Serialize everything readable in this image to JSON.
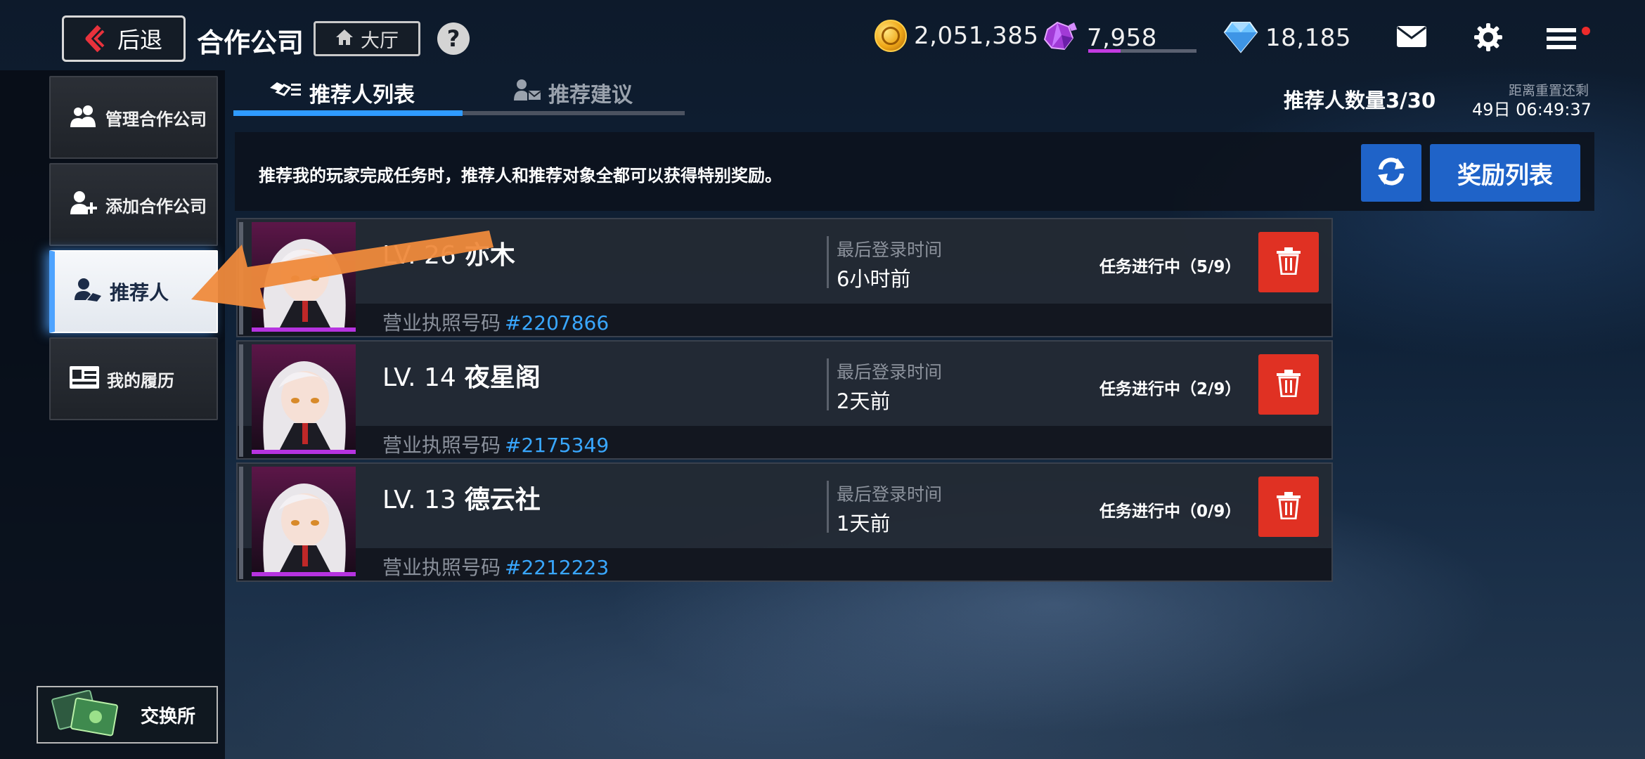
{
  "header": {
    "back_label": "后退",
    "company_title": "合作公司",
    "hall_label": "大厅",
    "help_symbol": "?",
    "currencies": [
      {
        "icon": "gold-coin-icon",
        "value": "2,051,385"
      },
      {
        "icon": "purple-crystal-icon",
        "value": "7,958",
        "bar_fill_fraction": 0.3
      },
      {
        "icon": "blue-diamond-icon",
        "value": "18,185"
      }
    ],
    "icons": [
      "mail-icon",
      "settings-icon",
      "menu-icon"
    ],
    "notify_color": "#ee2b2b"
  },
  "sidebar": {
    "items": [
      {
        "label": "管理合作公司",
        "icon": "users-icon",
        "active": false
      },
      {
        "label": "添加合作公司",
        "icon": "add-user-icon",
        "active": false
      },
      {
        "label": "推荐人",
        "icon": "handshake-icon",
        "active": true
      },
      {
        "label": "我的履历",
        "icon": "profile-card-icon",
        "active": false
      }
    ],
    "exchange_label": "交换所",
    "active_color": "#4ea3ff"
  },
  "tabs": [
    {
      "label": "推荐人列表",
      "icon": "handshake-list-icon",
      "active": true
    },
    {
      "label": "推荐建议",
      "icon": "user-mail-icon",
      "active": false
    }
  ],
  "status": {
    "referrer_count": "推荐人数量3/30",
    "reset_label": "距离重置还剩",
    "reset_time": "49日  06:49:37"
  },
  "banner": {
    "text": "推荐我的玩家完成任务时，推荐人和推荐对象全都可以获得特别奖励。",
    "refresh_icon": "refresh-icon",
    "rewards_label": "奖励列表",
    "button_color": "#1f63c8"
  },
  "referrers": [
    {
      "level": "LV. 26",
      "name": "亦木",
      "sub": "",
      "license_label": "营业执照号码",
      "license_no": "#2207866",
      "login_label": "最后登录时间",
      "login_value": "6小时前",
      "status": "任务进行中（5/9）"
    },
    {
      "level": "LV. 14",
      "name": "夜星阁",
      "sub": "",
      "license_label": "营业执照号码",
      "license_no": "#2175349",
      "login_label": "最后登录时间",
      "login_value": "2天前",
      "status": "任务进行中（2/9）"
    },
    {
      "level": "LV. 13",
      "name": "德云社",
      "sub": "",
      "license_label": "营业执照号码",
      "license_no": "#2212223",
      "login_label": "最后登录时间",
      "login_value": "1天前",
      "status": "任务进行中（0/9）"
    }
  ],
  "colors": {
    "accent_blue": "#2f9bff",
    "delete_red": "#e03123",
    "license_blue": "#39a7ff",
    "overlay_arrow": "#ef8a3c"
  }
}
